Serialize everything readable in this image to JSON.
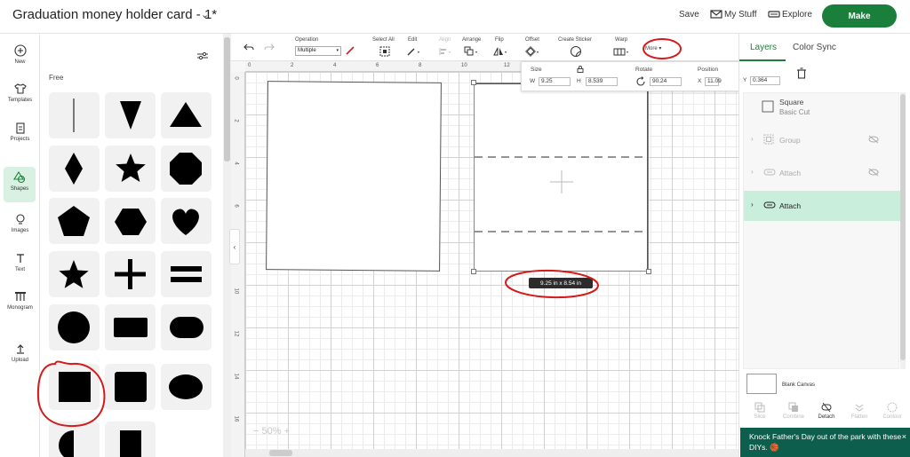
{
  "header": {
    "title": "Graduation money holder card - 1*",
    "title_chevron": "⌄",
    "save_label": "Save",
    "my_stuff_label": "My Stuff",
    "explore_label": "Explore",
    "make_label": "Make"
  },
  "left_nav": {
    "items": [
      {
        "label": "New",
        "icon": "plus-circle-icon"
      },
      {
        "label": "Templates",
        "icon": "shirt-icon"
      },
      {
        "label": "Projects",
        "icon": "clipboard-icon"
      },
      {
        "label": "Shapes",
        "icon": "shapes-icon",
        "active": true
      },
      {
        "label": "Images",
        "icon": "bulb-icon"
      },
      {
        "label": "Text",
        "icon": "text-icon"
      },
      {
        "label": "Monogram",
        "icon": "monogram-icon"
      },
      {
        "label": "Upload",
        "icon": "upload-icon"
      }
    ]
  },
  "shape_panel": {
    "section_label": "Free",
    "shapes": [
      "line",
      "inverted-triangle",
      "triangle",
      "diamond",
      "star",
      "octagon",
      "pentagon",
      "hexagon",
      "heart",
      "star-small",
      "cross",
      "equals",
      "circle",
      "rounded-rectangle",
      "pill",
      "square",
      "rounded-square",
      "oval",
      "half-circle",
      "square-partial"
    ]
  },
  "toolbar": {
    "operation_label": "Operation",
    "operation_value": "Multiple",
    "select_all_label": "Select All",
    "edit_label": "Edit",
    "align_label": "Align",
    "arrange_label": "Arrange",
    "flip_label": "Flip",
    "offset_label": "Offset",
    "create_sticker_label": "Create Sticker",
    "warp_label": "Warp",
    "more_label": "More ▾"
  },
  "size_popup": {
    "size_label": "Size",
    "w_label": "W",
    "w_value": "9.25",
    "h_label": "H",
    "h_value": "8.539",
    "rotate_label": "Rotate",
    "rotate_value": "90.24",
    "position_label": "Position",
    "x_label": "X",
    "x_value": "11.09",
    "y_label": "Y",
    "y_value": "0.364"
  },
  "canvas": {
    "ruler_top": [
      "0",
      "2",
      "4",
      "6",
      "8",
      "10",
      "12"
    ],
    "ruler_left": [
      "0",
      "2",
      "4",
      "6",
      "8",
      "10",
      "12",
      "14",
      "16"
    ],
    "dimension_badge": "9.25  in x 8.54  in",
    "zoom_value": "50%",
    "zoom_minus": "−",
    "zoom_plus": "+",
    "collapse_arrow": "‹"
  },
  "right_panel": {
    "tabs": [
      {
        "label": "Layers",
        "active": true
      },
      {
        "label": "Color Sync"
      }
    ],
    "layers": [
      {
        "label": "Square",
        "sublabel": "Basic Cut",
        "icon": "square-outline-icon"
      },
      {
        "label": "Group",
        "icon": "group-icon",
        "hidden": true
      },
      {
        "label": "Attach",
        "icon": "attach-icon",
        "hidden": true
      },
      {
        "label": "Attach",
        "icon": "attach-icon",
        "selected": true
      }
    ],
    "blank_canvas_label": "Blank Canvas",
    "actions": [
      {
        "label": "Slice",
        "enabled": false
      },
      {
        "label": "Combine",
        "enabled": false
      },
      {
        "label": "Detach",
        "enabled": true
      },
      {
        "label": "Flatten",
        "enabled": false
      },
      {
        "label": "Contour",
        "enabled": false
      }
    ]
  },
  "toast": {
    "text": "Knock Father's Day out of the park with these DIYs. 🏀",
    "close": "×"
  },
  "colors": {
    "brand_green": "#1b7f3c",
    "selected_layer": "#c9efdc",
    "annotation_red": "#d41a1a",
    "toast_bg": "#0e5e4e"
  }
}
